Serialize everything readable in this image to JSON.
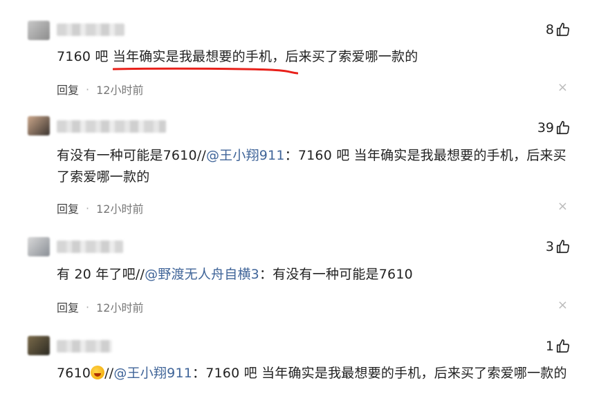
{
  "comments": [
    {
      "likes": "8",
      "text_plain": "7160 吧 当年确实是我最想要的手机，后来买了索爱哪一款的",
      "reply_label": "回复",
      "time": "12小时前"
    },
    {
      "likes": "39",
      "text_pre": "有没有一种可能是7610//",
      "mention": "@王小翔911",
      "text_post": "：7160 吧 当年确实是我最想要的手机，后来买了索爱哪一款的",
      "reply_label": "回复",
      "time": "12小时前"
    },
    {
      "likes": "3",
      "text_pre": "有 20 年了吧//",
      "mention": "@野渡无人舟自横3",
      "text_post": "：有没有一种可能是7610",
      "reply_label": "回复",
      "time": "12小时前"
    },
    {
      "likes": "1",
      "text_pre": "7610",
      "text_mid": "//",
      "mention": "@王小翔911",
      "text_post": "：7160 吧 当年确实是我最想要的手机，后来买了索爱哪一款的"
    }
  ],
  "icons": {
    "like": "thumbs-up-icon",
    "close": "close-icon",
    "emoji": "laughing-emoji-icon"
  },
  "colors": {
    "mention": "#406599",
    "annotation": "#e8201a"
  },
  "separator": "·",
  "close_glyph": "×"
}
